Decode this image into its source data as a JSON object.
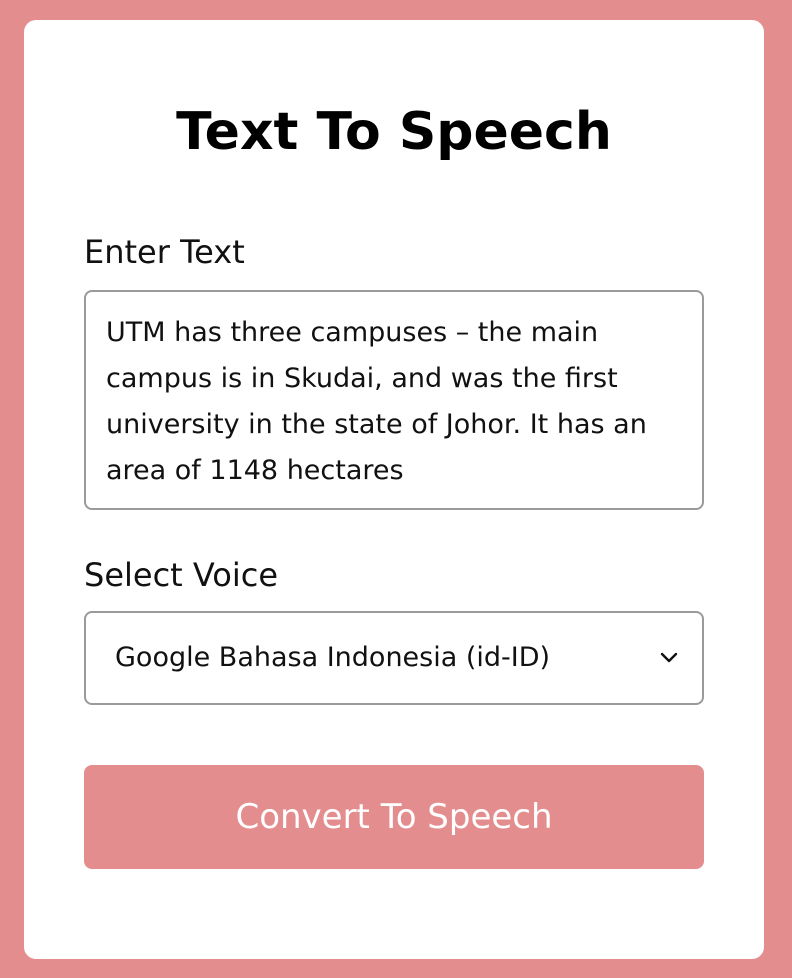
{
  "app": {
    "title": "Text To Speech"
  },
  "text_input": {
    "label": "Enter Text",
    "value": "UTM has three campuses – the main campus is in Skudai, and was the first university in the state of Johor. It has an area of 1148 hectares"
  },
  "voice_select": {
    "label": "Select Voice",
    "selected": "Google Bahasa Indonesia (id-ID)",
    "icon": "chevron-down-icon"
  },
  "convert_button": {
    "label": "Convert To Speech"
  },
  "colors": {
    "background": "#e38d8f",
    "card": "#ffffff",
    "button": "#e38d8f",
    "button_text": "#ffffff",
    "border": "#9a9a9a"
  }
}
